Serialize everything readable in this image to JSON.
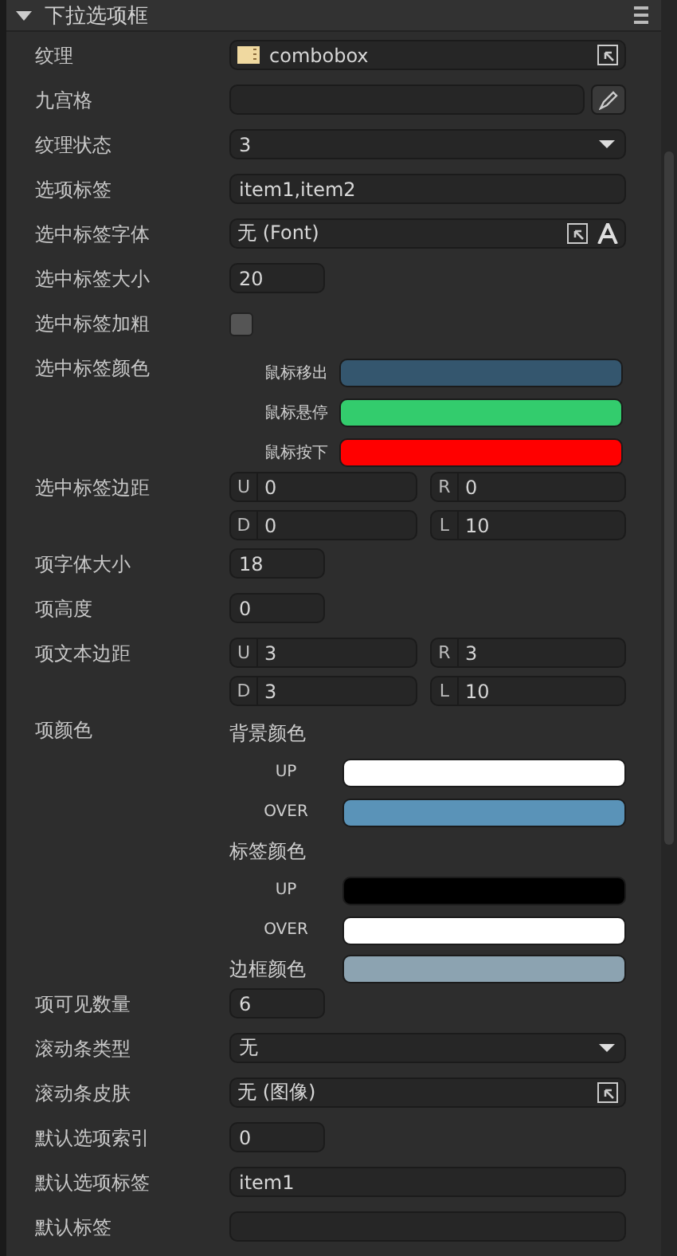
{
  "panel": {
    "title": "下拉选项框",
    "expanded": true
  },
  "rows": [
    {
      "kind": "texture",
      "label": "纹理",
      "value": "combobox"
    },
    {
      "kind": "ninegrid",
      "label": "九宫格"
    },
    {
      "kind": "select",
      "label": "纹理状态",
      "value": "3"
    },
    {
      "kind": "text",
      "label": "选项标签",
      "value": "item1,item2"
    },
    {
      "kind": "font",
      "label": "选中标签字体",
      "value": "无 (Font)"
    },
    {
      "kind": "number",
      "label": "选中标签大小",
      "value": "20"
    },
    {
      "kind": "checkbox",
      "label": "选中标签加粗",
      "checked": false
    },
    {
      "kind": "states",
      "label": "选中标签颜色",
      "states": [
        {
          "label": "鼠标移出",
          "color": "#34566e"
        },
        {
          "label": "鼠标悬停",
          "color": "#33cc6d"
        },
        {
          "label": "鼠标按下",
          "color": "#ff0000"
        }
      ]
    },
    {
      "kind": "padding",
      "label": "选中标签边距",
      "fields": [
        {
          "key": "U",
          "value": "0"
        },
        {
          "key": "R",
          "value": "0"
        },
        {
          "key": "D",
          "value": "0"
        },
        {
          "key": "L",
          "value": "10"
        }
      ]
    },
    {
      "kind": "number",
      "label": "项字体大小",
      "value": "18"
    },
    {
      "kind": "number",
      "label": "项高度",
      "value": "0"
    },
    {
      "kind": "padding",
      "label": "项文本边距",
      "fields": [
        {
          "key": "U",
          "value": "3"
        },
        {
          "key": "R",
          "value": "3"
        },
        {
          "key": "D",
          "value": "3"
        },
        {
          "key": "L",
          "value": "10"
        }
      ]
    },
    {
      "kind": "itemcolors",
      "label": "项颜色",
      "groups": [
        {
          "title": "背景颜色",
          "entries": [
            {
              "label": "UP",
              "color": "#ffffff"
            },
            {
              "label": "OVER",
              "color": "#5a93b8"
            }
          ]
        },
        {
          "title": "标签颜色",
          "entries": [
            {
              "label": "UP",
              "color": "#000000"
            },
            {
              "label": "OVER",
              "color": "#ffffff"
            }
          ]
        },
        {
          "title": "边框颜色",
          "color": "#8ca3b1"
        }
      ]
    },
    {
      "kind": "number",
      "label": "项可见数量",
      "value": "6"
    },
    {
      "kind": "select",
      "label": "滚动条类型",
      "value": "无"
    },
    {
      "kind": "image",
      "label": "滚动条皮肤",
      "value": "无 (图像)"
    },
    {
      "kind": "number",
      "label": "默认选项索引",
      "value": "0"
    },
    {
      "kind": "text",
      "label": "默认选项标签",
      "value": "item1"
    },
    {
      "kind": "text",
      "label": "默认标签",
      "value": ""
    }
  ]
}
